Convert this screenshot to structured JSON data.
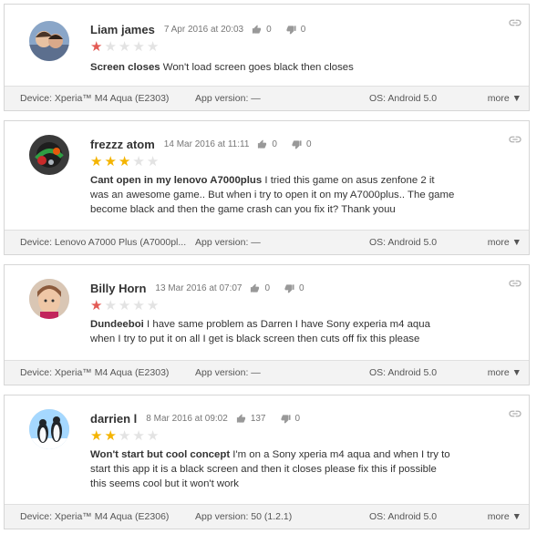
{
  "reviews": [
    {
      "author": "Liam james",
      "date": "7 Apr 2016 at 20:03",
      "thumbs_up": "0",
      "thumbs_down": "0",
      "rating": 1,
      "title": "Screen closes",
      "body": "Won't load screen goes black then closes",
      "device": "Device: Xperia™ M4 Aqua (E2303)",
      "app_version": "App version: —",
      "os": "OS: Android 5.0",
      "more": "more ▼",
      "star_color": "#e35b55"
    },
    {
      "author": "frezzz atom",
      "date": "14 Mar 2016 at 11:11",
      "thumbs_up": "0",
      "thumbs_down": "0",
      "rating": 3,
      "title": "Cant open in my lenovo A7000plus",
      "body": "I tried this game on asus zenfone 2 it was an awesome game.. But when i try to open it on my A7000plus.. The game become black and then the game crash can you fix it? Thank youu",
      "device": "Device: Lenovo A7000 Plus (A7000pl...",
      "app_version": "App version: —",
      "os": "OS: Android 5.0",
      "more": "more ▼",
      "star_color": "#f4b400"
    },
    {
      "author": "Billy Horn",
      "date": "13 Mar 2016 at 07:07",
      "thumbs_up": "0",
      "thumbs_down": "0",
      "rating": 1,
      "title": "Dundeeboi",
      "body": "I have same problem as Darren I have Sony experia m4 aqua when I try to put it on all I get is black screen then cuts off fix this please",
      "device": "Device: Xperia™ M4 Aqua (E2303)",
      "app_version": "App version: —",
      "os": "OS: Android 5.0",
      "more": "more ▼",
      "star_color": "#e35b55"
    },
    {
      "author": "darrien l",
      "date": "8 Mar 2016 at 09:02",
      "thumbs_up": "137",
      "thumbs_down": "0",
      "rating": 2,
      "title": "Won't start but cool concept",
      "body": "I'm on a Sony xperia m4 aqua and when I try to start this app it is a black screen and then it closes please fix this if possible this seems cool but it won't work",
      "device": "Device: Xperia™ M4 Aqua (E2306)",
      "app_version": "App version: 50 (1.2.1)",
      "os": "OS: Android 5.0",
      "more": "more ▼",
      "star_color": "#f4b400"
    }
  ],
  "icons": {
    "link": "link-icon",
    "thumbs_up": "thumbs-up-icon",
    "thumbs_down": "thumbs-down-icon",
    "star": "star-icon"
  }
}
